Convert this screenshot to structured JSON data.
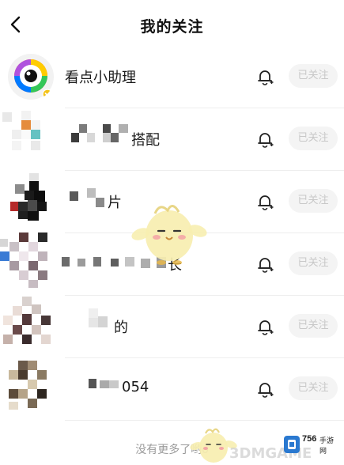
{
  "header": {
    "title": "我的关注",
    "back_icon": "chevron-left-icon"
  },
  "follow_list": [
    {
      "name": "看点小助理",
      "follow_label": "已关注"
    },
    {
      "name": "搭配",
      "follow_label": "已关注"
    },
    {
      "name": "片",
      "follow_label": "已关注"
    },
    {
      "name": "长",
      "follow_label": "已关注"
    },
    {
      "name": "的",
      "follow_label": "已关注"
    },
    {
      "name": "054",
      "follow_label": "已关注"
    }
  ],
  "footer": {
    "text": "没有更多了哟o"
  },
  "watermark": {
    "site_number": "756",
    "site_suffix": "手游网",
    "brand": "3DMGAME"
  },
  "colors": {
    "follow_btn_bg": "#f4f4f4",
    "follow_btn_text": "#c8c8c8",
    "footer_text": "#9a9a9a"
  }
}
